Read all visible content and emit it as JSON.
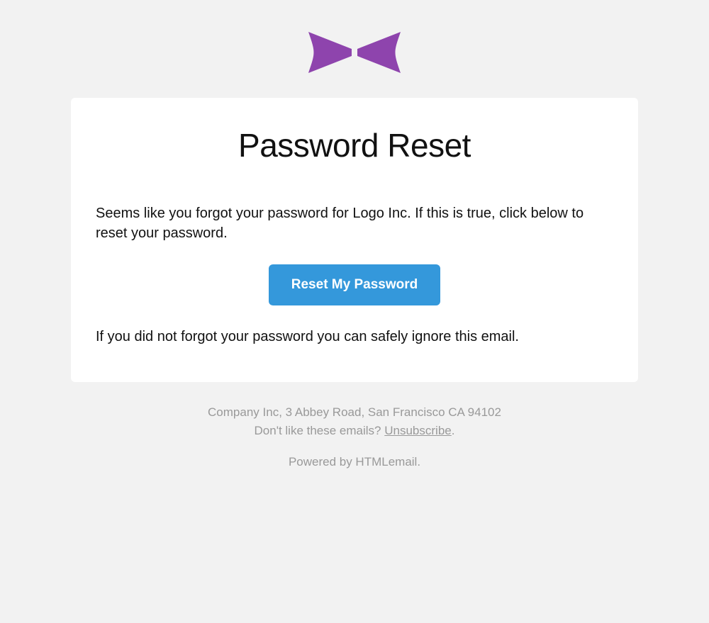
{
  "header": {
    "title": "Password Reset"
  },
  "body": {
    "intro_text": "Seems like you forgot your password for Logo Inc. If this is true, click below to reset your password.",
    "button_label": "Reset My Password",
    "ignore_text": "If you did not forgot your password you can safely ignore this email."
  },
  "footer": {
    "address": "Company Inc, 3 Abbey Road, San Francisco CA 94102",
    "unsubscribe_prompt": "Don't like these emails? ",
    "unsubscribe_label": "Unsubscribe",
    "unsubscribe_suffix": ".",
    "powered_by": "Powered by HTMLemail."
  },
  "colors": {
    "accent": "#8e44ad",
    "button": "#3498db"
  }
}
